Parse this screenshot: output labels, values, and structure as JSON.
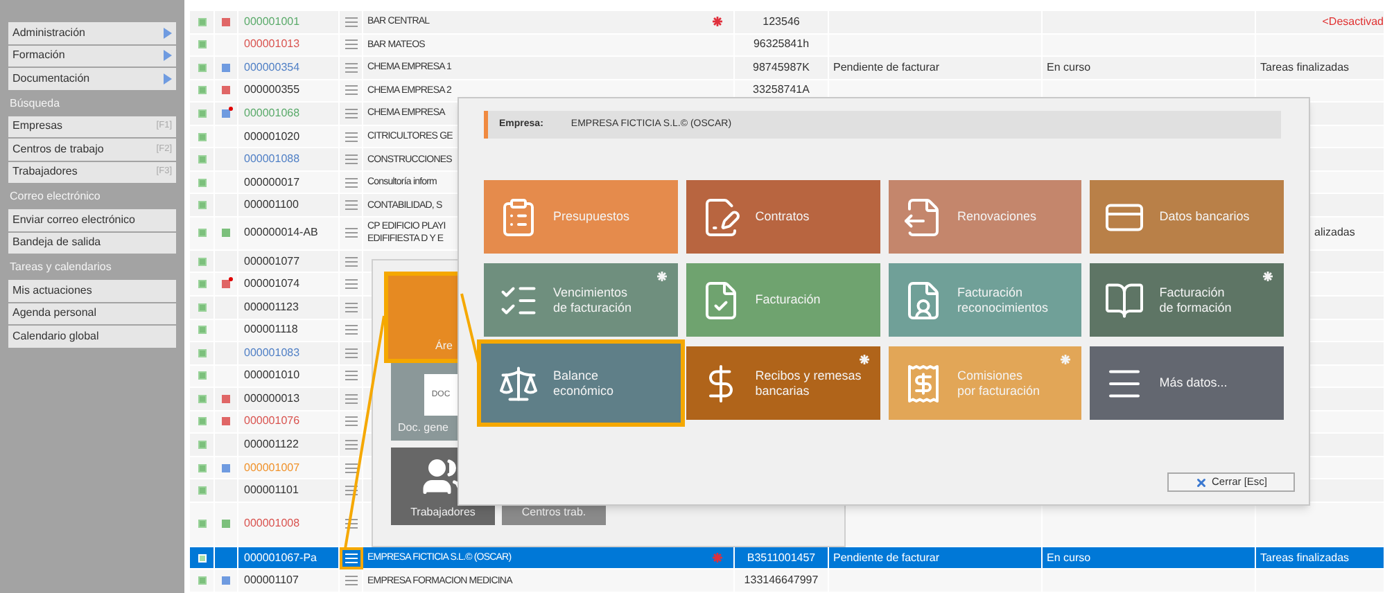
{
  "sidebar": {
    "sections": [
      {
        "items": [
          {
            "label": "Administración",
            "submenu": true
          },
          {
            "label": "Formación",
            "submenu": true
          },
          {
            "label": "Documentación",
            "submenu": true
          }
        ]
      },
      {
        "header": "Búsqueda",
        "items": [
          {
            "label": "Empresas",
            "shortcut": "[F1]"
          },
          {
            "label": "Centros de trabajo",
            "shortcut": "[F2]"
          },
          {
            "label": "Trabajadores",
            "shortcut": "[F3]"
          }
        ]
      },
      {
        "header": "Correo electrónico",
        "items": [
          {
            "label": "Enviar correo electrónico"
          },
          {
            "label": "Bandeja de salida"
          }
        ]
      },
      {
        "header": "Tareas y calendarios",
        "items": [
          {
            "label": "Mis actuaciones"
          },
          {
            "label": "Agenda personal"
          },
          {
            "label": "Calendario global"
          }
        ]
      }
    ]
  },
  "table": {
    "rows": [
      {
        "selected": false,
        "marker": {
          "color": "#e06666",
          "flagged": false
        },
        "code": {
          "text": "000001001",
          "color": "#5aaa6a"
        },
        "name": "BAR CENTRAL",
        "starred": true,
        "nif": "123546",
        "tasks": {
          "text": "<Desactivad",
          "kind": "warning"
        }
      },
      {
        "selected": false,
        "code": {
          "text": "000001013",
          "color": "#d9534f"
        },
        "name": "BAR MATEOS",
        "starred": false,
        "nif": "96325841h"
      },
      {
        "selected": false,
        "marker": {
          "color": "#6f9be0",
          "flagged": false
        },
        "code": {
          "text": "000000354",
          "color": "#4f7fc5"
        },
        "name": "CHEMA EMPRESA 1",
        "starred": false,
        "nif": "98745987K",
        "billing": "Pendiente de facturar",
        "phase": "En curso",
        "tasks": {
          "text": "Tareas finalizadas",
          "kind": "normal"
        }
      },
      {
        "selected": false,
        "marker": {
          "color": "#e06666",
          "flagged": false
        },
        "code": {
          "text": "000000355",
          "color": "#333333"
        },
        "name": "CHEMA EMPRESA 2",
        "starred": false,
        "nif": "33258741A"
      },
      {
        "selected": false,
        "marker": {
          "color": "#6f9be0",
          "flagged": true
        },
        "code": {
          "text": "000001068",
          "color": "#5aaa6a"
        },
        "name": "CHEMA EMPRESA"
      },
      {
        "selected": false,
        "code": {
          "text": "000001020",
          "color": "#333333"
        },
        "name": "CITRICULTORES GE"
      },
      {
        "selected": false,
        "code": {
          "text": "000001088",
          "color": "#4f7fc5"
        },
        "name": "CONSTRUCCIONES"
      },
      {
        "selected": false,
        "code": {
          "text": "000000017",
          "color": "#333333"
        },
        "name": "Consultoría inform"
      },
      {
        "selected": false,
        "code": {
          "text": "000001100",
          "color": "#333333"
        },
        "name": "CONTABILIDAD, S"
      },
      {
        "selected": false,
        "tall": true,
        "marker": {
          "color": "#7cc07c",
          "flagged": false
        },
        "code": {
          "text": "000000014-AB",
          "color": "#333333"
        },
        "name": "CP EDIFICIO PLAYI\nEDIFIFIESTA D Y E",
        "tasks": {
          "text": "alizadas",
          "kind": "clipped"
        }
      },
      {
        "selected": false,
        "code": {
          "text": "000001077",
          "color": "#333333"
        }
      },
      {
        "selected": false,
        "marker": {
          "color": "#e06666",
          "flagged": true
        },
        "code": {
          "text": "000001074",
          "color": "#333333"
        }
      },
      {
        "selected": false,
        "code": {
          "text": "000001123",
          "color": "#333333"
        }
      },
      {
        "selected": false,
        "code": {
          "text": "000001118",
          "color": "#333333"
        }
      },
      {
        "selected": false,
        "code": {
          "text": "000001083",
          "color": "#4f7fc5"
        }
      },
      {
        "selected": false,
        "code": {
          "text": "000001010",
          "color": "#333333"
        }
      },
      {
        "selected": false,
        "marker": {
          "color": "#e06666",
          "flagged": false
        },
        "code": {
          "text": "000000013",
          "color": "#333333"
        }
      },
      {
        "selected": false,
        "marker": {
          "color": "#e06666",
          "flagged": false
        },
        "code": {
          "text": "000001076",
          "color": "#d9534f"
        }
      },
      {
        "selected": false,
        "code": {
          "text": "000001122",
          "color": "#333333"
        }
      },
      {
        "selected": false,
        "marker": {
          "color": "#6f9be0",
          "flagged": false
        },
        "code": {
          "text": "000001007",
          "color": "#f0922b"
        }
      },
      {
        "selected": false,
        "code": {
          "text": "000001101",
          "color": "#333333"
        }
      },
      {
        "selected": false,
        "tall": true,
        "marker": {
          "color": "#7cc07c",
          "flagged": false
        },
        "code": {
          "text": "000001008",
          "color": "#d9534f"
        }
      },
      {
        "selected": true,
        "code": {
          "text": "000001067-Pa",
          "color": "#ffffff"
        },
        "name": "EMPRESA FICTICIA S.L.© (OSCAR)",
        "starred": true,
        "nif": "B3511001457",
        "billing": "Pendiente de facturar",
        "phase": "En curso",
        "tasks": {
          "text": "Tareas finalizadas",
          "kind": "normal"
        }
      },
      {
        "selected": false,
        "marker": {
          "color": "#6f9be0",
          "flagged": false
        },
        "code": {
          "text": "000001107",
          "color": "#333333"
        },
        "name": "EMPRESA FORMACION MEDICINA",
        "starred": false,
        "nif": "133146647997"
      }
    ]
  },
  "area_panel": {
    "tiles": [
      {
        "label": "Áre",
        "color": "#e68a22",
        "selected": true
      },
      {
        "label": "Doc. gene",
        "color": "#8b9899",
        "selected": false,
        "icon_text": "DOC"
      },
      {
        "label": "Trabajadores",
        "color": "#676767",
        "selected": false
      },
      {
        "label": "Centros trab.",
        "color": "#8a8a8a",
        "selected": false
      }
    ]
  },
  "dialog": {
    "company_label": "Empresa:",
    "company": "EMPRESA FICTICIA S.L.© (OSCAR)",
    "tiles": [
      {
        "label": "Presupuestos",
        "color": "#e58b4c",
        "starred": false,
        "selected": false
      },
      {
        "label": "Contratos",
        "color": "#b86540",
        "starred": false,
        "selected": false
      },
      {
        "label": "Renovaciones",
        "color": "#c4866c",
        "starred": false,
        "selected": false
      },
      {
        "label": "Datos bancarios",
        "color": "#b98048",
        "starred": false,
        "selected": false
      },
      {
        "label": "Vencimientos\nde facturación",
        "color": "#6f8f7e",
        "starred": true,
        "selected": false
      },
      {
        "label": "Facturación",
        "color": "#6fa36f",
        "starred": false,
        "selected": false
      },
      {
        "label": "Facturación\nreconocimientos",
        "color": "#70a098",
        "starred": false,
        "selected": false
      },
      {
        "label": "Facturación\nde formación",
        "color": "#5e7565",
        "starred": true,
        "selected": false
      },
      {
        "label": "Balance\neconómico",
        "color": "#5f7f88",
        "starred": false,
        "selected": true
      },
      {
        "label": "Recibos y remesas\nbancarias",
        "color": "#b0641a",
        "starred": true,
        "selected": false
      },
      {
        "label": "Comisiones\npor facturación",
        "color": "#e2a657",
        "starred": true,
        "selected": false
      },
      {
        "label": "Más datos...",
        "color": "#636770",
        "starred": false,
        "selected": false
      }
    ],
    "close_button": "Cerrar [Esc]"
  }
}
